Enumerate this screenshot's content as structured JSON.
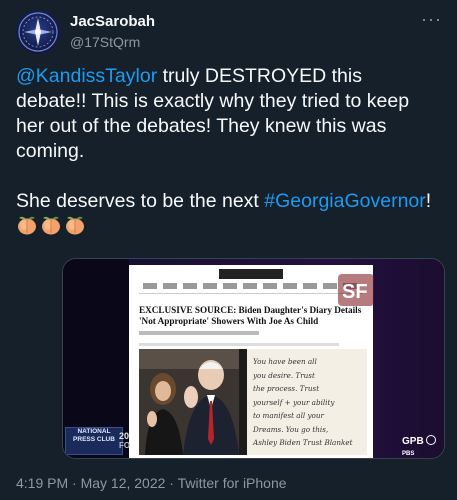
{
  "author": {
    "display_name": "JacSarobah",
    "handle": "@17StQrm",
    "avatar_icon": "space-badge-icon"
  },
  "more_icon": "ellipsis-icon",
  "tweet": {
    "mention": "@KandissTaylor",
    "text1": " truly DESTROYED this debate!! This is exactly why they tried to keep her out of the debates! They knew this was coming.",
    "text2": "She deserves to be the next ",
    "hashtag": "#GeorgiaGovernor",
    "text3": "!",
    "emoji": [
      "peach-emoji",
      "peach-emoji",
      "peach-emoji"
    ]
  },
  "media": {
    "headline": "EXCLUSIVE SOURCE: Biden Daughter's Diary Details 'Not Appropriate' Showers With Joe As Child",
    "handwriting_lines": [
      "You have been all",
      "you desire. Trust",
      "the process. Trust",
      "yourself + your ability",
      "to manifest all your",
      "Dreams. You go this,",
      "Ashley Biden Trust Blanket"
    ],
    "press_club_text": "NATIONAL PRESS CLUB",
    "year_text": "20",
    "year_sub": "FO",
    "corner_logo_text": "SF",
    "network_text": "GPB",
    "network_sub": "PBS"
  },
  "footer": {
    "timestamp": "4:19 PM · May 12, 2022 · Twitter for iPhone"
  },
  "colors": {
    "background": "#15202b",
    "text": "#f7f9f9",
    "link": "#1d9bf0",
    "muted": "#8b98a5"
  }
}
